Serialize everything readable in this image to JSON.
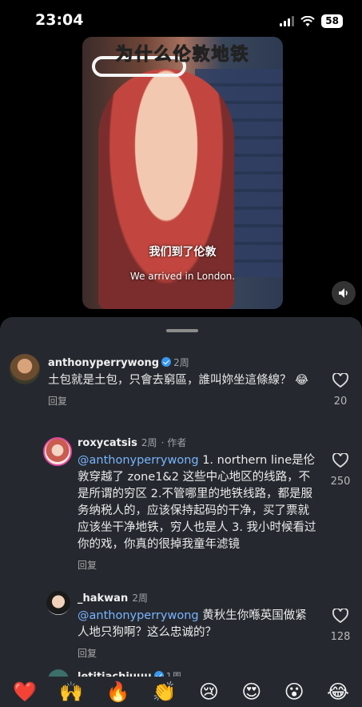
{
  "status_bar": {
    "time": "23:04",
    "battery": "58"
  },
  "video": {
    "title_overlay": "为什么伦敦地铁",
    "subtitle_cn": "我们到了伦敦",
    "subtitle_en": "We arrived in London."
  },
  "comments": [
    {
      "username": "anthonyperrywong",
      "verified": true,
      "time": "2周",
      "text": "土包就是土包，只會去窮區，誰叫妳坐這條線？ 😂",
      "reply_label": "回复",
      "likes": "20"
    },
    {
      "username": "roxycatsis",
      "time": "2周",
      "author_tag": "· 作者",
      "mention": "@anthonyperrywong",
      "text": " 1. northern line是伦敦穿越了 zone1&2 这些中心地区的线路，不是所谓的穷区 2.不管哪里的地铁线路，都是服务纳税人的，应该保持起码的干净，买了票就应该坐干净地铁，穷人也是人 3. 我小时候看过你的戏，你真的很掉我童年滤镜",
      "reply_label": "回复",
      "likes": "250"
    },
    {
      "username": "_hakwan",
      "time": "2周",
      "mention": "@anthonyperrywong",
      "text": " 黄秋生你喺英国做紧人地只狗啊？这么忠诚的？",
      "reply_label": "回复",
      "likes": "128"
    },
    {
      "username": "letitiachiuuu",
      "time": "1周"
    }
  ],
  "emoji_bar": [
    "❤️",
    "🙌",
    "🔥",
    "👏",
    "😢",
    "😍",
    "😮",
    "😂"
  ]
}
